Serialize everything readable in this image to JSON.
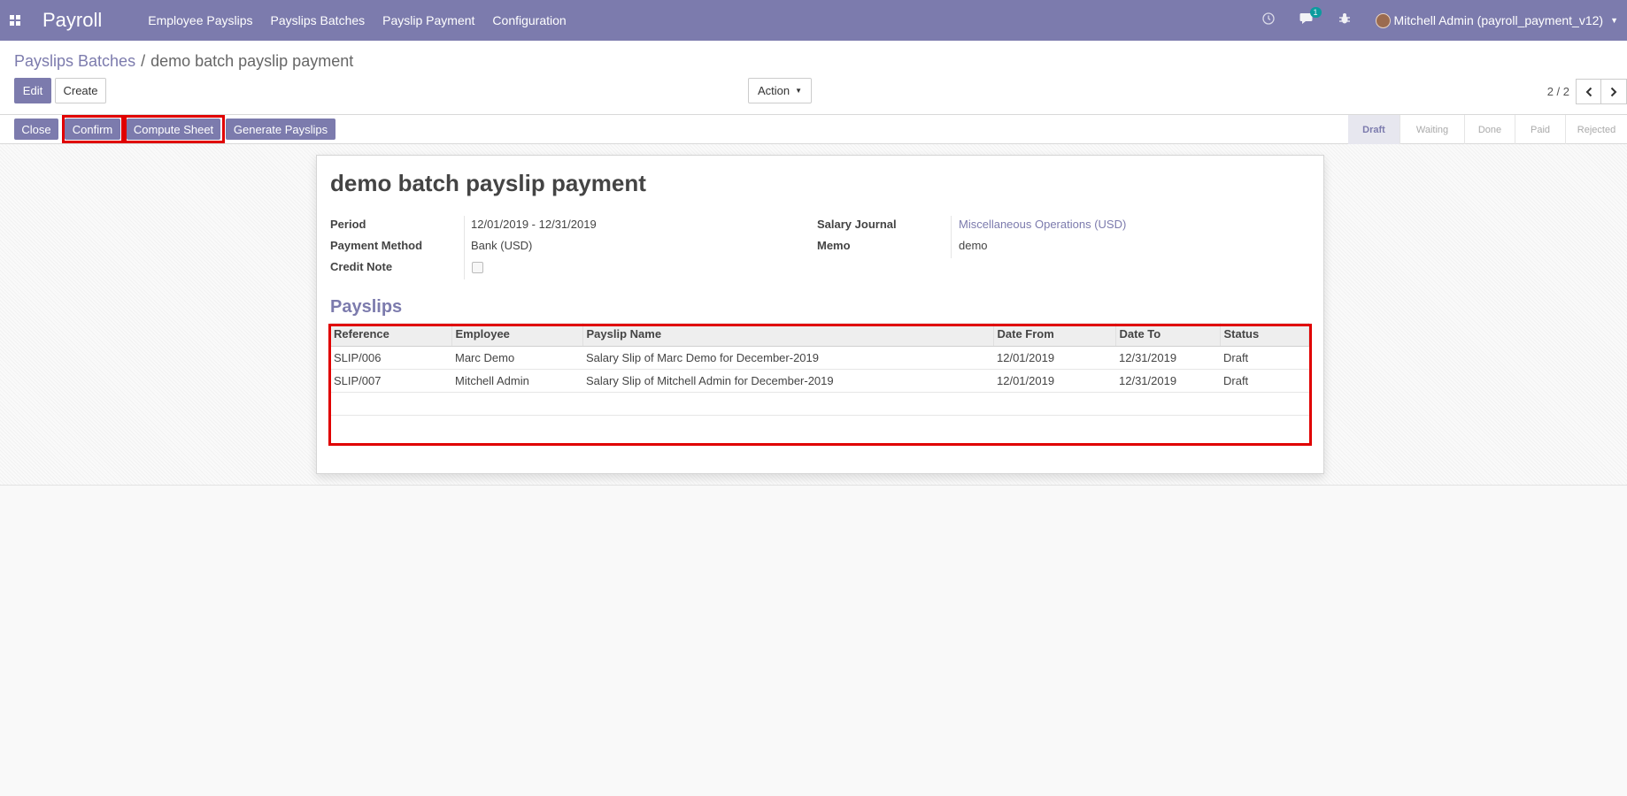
{
  "navbar": {
    "app_name": "Payroll",
    "menu": [
      "Employee Payslips",
      "Payslips Batches",
      "Payslip Payment",
      "Configuration"
    ],
    "messages_count": "1",
    "user_label": "Mitchell Admin (payroll_payment_v12)",
    "icons": [
      "apps-grid-icon",
      "clock-icon",
      "chat-icon",
      "bug-icon",
      "avatar"
    ]
  },
  "breadcrumb": {
    "parent": "Payslips Batches",
    "separator": "/",
    "current": "demo batch payslip payment"
  },
  "control_panel": {
    "edit_label": "Edit",
    "create_label": "Create",
    "action_label": "Action",
    "pager_value": "2 / 2"
  },
  "statusbar": {
    "buttons": [
      "Close",
      "Confirm",
      "Compute Sheet",
      "Generate Payslips"
    ],
    "stages": [
      "Draft",
      "Waiting",
      "Done",
      "Paid",
      "Rejected"
    ],
    "active_stage": "Draft"
  },
  "sheet": {
    "title": "demo batch payslip payment",
    "period_label": "Period",
    "period_value": "12/01/2019 - 12/31/2019",
    "payment_method_label": "Payment Method",
    "payment_method_value": "Bank (USD)",
    "credit_note_label": "Credit Note",
    "credit_note_checked": false,
    "salary_journal_label": "Salary Journal",
    "salary_journal_value": "Miscellaneous Operations (USD)",
    "memo_label": "Memo",
    "memo_value": "demo",
    "section_title": "Payslips"
  },
  "payslips_table": {
    "columns": [
      "Reference",
      "Employee",
      "Payslip Name",
      "Date From",
      "Date To",
      "Status"
    ],
    "rows": [
      [
        "SLIP/006",
        "Marc Demo",
        "Salary Slip of Marc Demo for December-2019",
        "12/01/2019",
        "12/31/2019",
        "Draft"
      ],
      [
        "SLIP/007",
        "Mitchell Admin",
        "Salary Slip of Mitchell Admin for December-2019",
        "12/01/2019",
        "12/31/2019",
        "Draft"
      ]
    ]
  },
  "colors": {
    "brand": "#7c7bad",
    "highlight": "#e00000"
  }
}
